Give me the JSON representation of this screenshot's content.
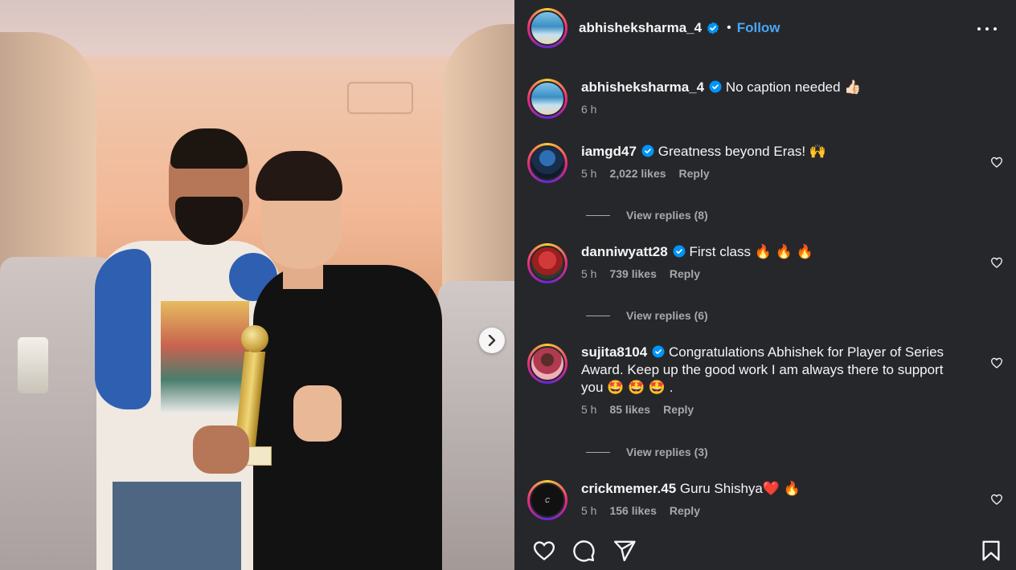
{
  "post": {
    "username": "abhisheksharma_4",
    "separator": "•",
    "follow_label": "Follow",
    "caption": "No caption needed 👍🏻",
    "caption_time": "6 h"
  },
  "comments": [
    {
      "username": "iamgd47",
      "text": "Greatness beyond Eras! 🙌",
      "time": "5 h",
      "likes": "2,022 likes",
      "reply_label": "Reply",
      "view_replies": "View replies (8)"
    },
    {
      "username": "danniwyatt28",
      "text": "First class 🔥 🔥 🔥",
      "time": "5 h",
      "likes": "739 likes",
      "reply_label": "Reply",
      "view_replies": "View replies (6)"
    },
    {
      "username": "sujita8104",
      "text": "Congratulations Abhishek for Player of Series Award. Keep up the good work I am always there to support you 🤩 🤩 🤩 .",
      "time": "5 h",
      "likes": "85 likes",
      "reply_label": "Reply",
      "view_replies": "View replies (3)"
    },
    {
      "username": "crickmemer.45",
      "text": "Guru Shishya❤️ 🔥",
      "time": "5 h",
      "likes": "156 likes",
      "reply_label": "Reply"
    }
  ],
  "colors": {
    "panel_bg": "#26272b",
    "follow_blue": "#4aa6f6",
    "verified_blue": "#0095f6",
    "muted_text": "#a8a8a8"
  },
  "icons": {
    "next": "chevron-right-icon",
    "more": "more-horizontal-icon",
    "like": "heart-icon",
    "comment": "comment-icon",
    "share": "share-icon",
    "save": "bookmark-icon",
    "verified": "verified-badge-icon"
  }
}
